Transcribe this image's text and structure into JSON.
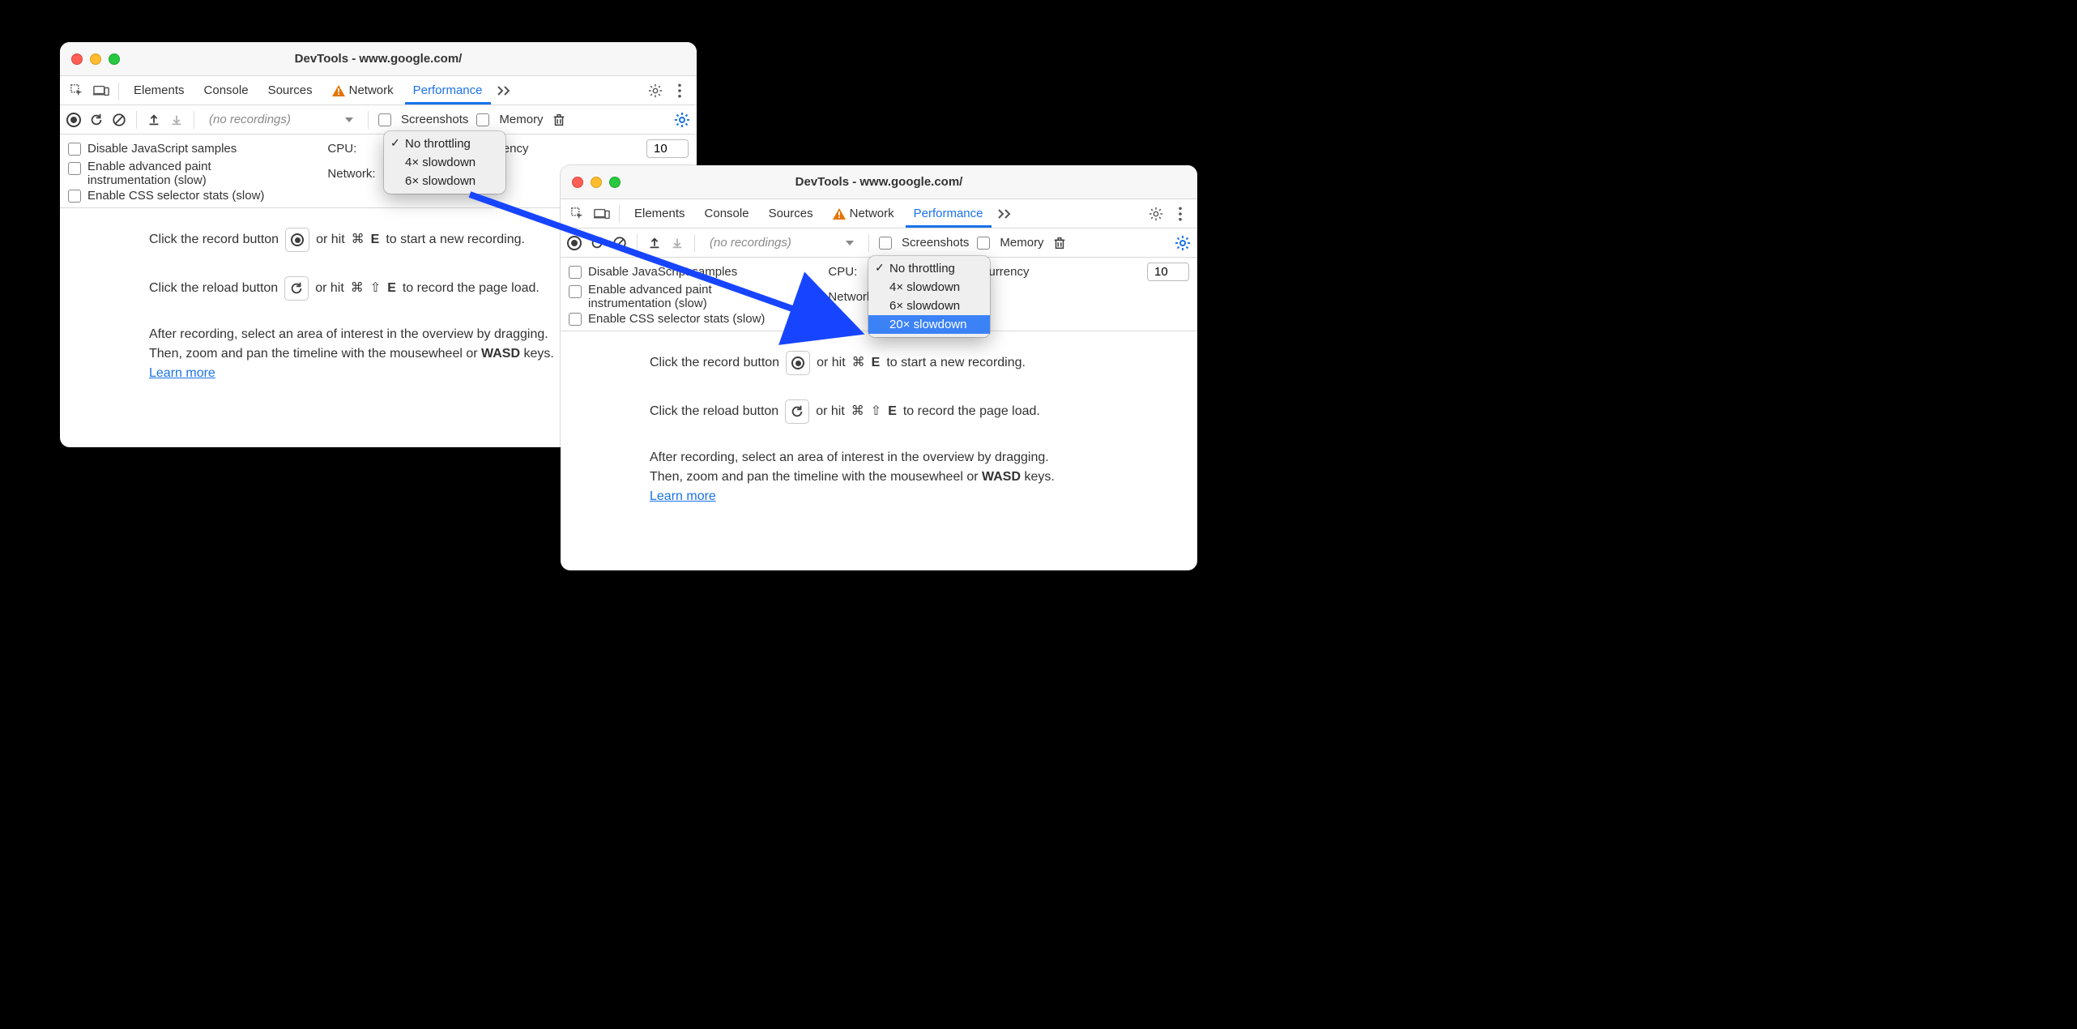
{
  "windowA": {
    "title": "DevTools - www.google.com/",
    "tabs": {
      "elements": "Elements",
      "console": "Console",
      "sources": "Sources",
      "network": "Network",
      "performance": "Performance"
    },
    "toolbar": {
      "recordings_placeholder": "(no recordings)",
      "screenshots": "Screenshots",
      "memory": "Memory"
    },
    "options": {
      "disable_js": "Disable JavaScript samples",
      "enable_paint": "Enable advanced paint instrumentation (slow)",
      "enable_css": "Enable CSS selector stats (slow)",
      "cpu_label": "CPU:",
      "network_label": "Network:",
      "hw_label": "Hardware concurrency",
      "hw_value": "10"
    },
    "dropdown": {
      "items": [
        "No throttling",
        "4× slowdown",
        "6× slowdown"
      ],
      "checked_index": 0,
      "highlighted_index": -1
    },
    "help": {
      "rec1_a": "Click the record button",
      "rec1_b": "or hit",
      "rec1_shortcut_mod": "⌘",
      "rec1_shortcut_key": "E",
      "rec1_c": "to start a new recording.",
      "rel1_a": "Click the reload button",
      "rel1_b": "or hit",
      "rel1_shortcut_mod": "⌘",
      "rel1_shortcut_shift": "⇧",
      "rel1_shortcut_key": "E",
      "rel1_c": "to record the page load.",
      "para_a": "After recording, select an area of interest in the overview by dragging.",
      "para_b_prefix": "Then, zoom and pan the timeline with the mousewheel or ",
      "para_b_bold": "WASD",
      "para_b_suffix": " keys.",
      "learn_more": "Learn more"
    }
  },
  "windowB": {
    "title": "DevTools - www.google.com/",
    "tabs": {
      "elements": "Elements",
      "console": "Console",
      "sources": "Sources",
      "network": "Network",
      "performance": "Performance"
    },
    "toolbar": {
      "recordings_placeholder": "(no recordings)",
      "screenshots": "Screenshots",
      "memory": "Memory"
    },
    "options": {
      "disable_js": "Disable JavaScript samples",
      "enable_paint": "Enable advanced paint instrumentation (slow)",
      "enable_css": "Enable CSS selector stats (slow)",
      "cpu_label": "CPU:",
      "network_label": "Network:",
      "hw_label": "Hardware concurrency",
      "hw_value": "10"
    },
    "dropdown": {
      "items": [
        "No throttling",
        "4× slowdown",
        "6× slowdown",
        "20× slowdown"
      ],
      "checked_index": 0,
      "highlighted_index": 3
    },
    "help": {
      "rec1_a": "Click the record button",
      "rec1_b": "or hit",
      "rec1_shortcut_mod": "⌘",
      "rec1_shortcut_key": "E",
      "rec1_c": "to start a new recording.",
      "rel1_a": "Click the reload button",
      "rel1_b": "or hit",
      "rel1_shortcut_mod": "⌘",
      "rel1_shortcut_shift": "⇧",
      "rel1_shortcut_key": "E",
      "rel1_c": "to record the page load.",
      "para_a": "After recording, select an area of interest in the overview by dragging.",
      "para_b_prefix": "Then, zoom and pan the timeline with the mousewheel or ",
      "para_b_bold": "WASD",
      "para_b_suffix": " keys.",
      "learn_more": "Learn more"
    }
  }
}
